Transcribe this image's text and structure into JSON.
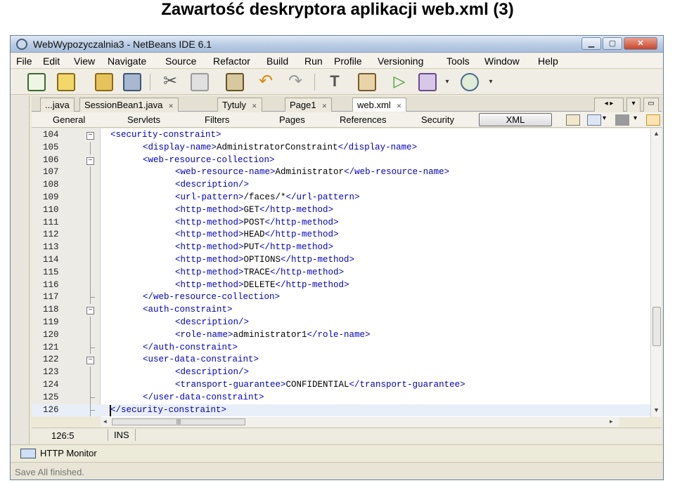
{
  "slide_title": "Zawartość deskryptora aplikacji web.xml (3)",
  "window": {
    "title": "WebWypozyczalnia3 - NetBeans IDE 6.1",
    "controls": [
      "minimize-icon",
      "maximize-icon",
      "close-icon"
    ]
  },
  "menu": [
    "File",
    "Edit",
    "View",
    "Navigate",
    "Source",
    "Refactor",
    "Build",
    "Run",
    "Profile",
    "Versioning",
    "Tools",
    "Window",
    "Help"
  ],
  "toolbar_icons": [
    "new-file-icon",
    "new-project-icon",
    "open-project-icon",
    "save-all-icon",
    "cut-icon",
    "copy-icon",
    "paste-icon",
    "undo-icon",
    "redo-icon",
    "build-icon",
    "clean-build-icon",
    "run-icon",
    "debug-icon",
    "profile-icon"
  ],
  "file_tabs": [
    {
      "label": "...java",
      "active": false
    },
    {
      "label": "SessionBean1.java",
      "active": false
    },
    {
      "label": "Tytuly",
      "active": false
    },
    {
      "label": "Page1",
      "active": false
    },
    {
      "label": "web.xml",
      "active": true
    }
  ],
  "multiview_tabs": [
    "General",
    "Servlets",
    "Filters",
    "Pages",
    "References",
    "Security",
    "XML"
  ],
  "active_view": "XML",
  "code_lines": [
    {
      "n": "104",
      "indent": 0,
      "text": "<security-constraint>"
    },
    {
      "n": "105",
      "indent": 1,
      "text": "<display-name>AdministratorConstraint</display-name>"
    },
    {
      "n": "106",
      "indent": 1,
      "text": "<web-resource-collection>"
    },
    {
      "n": "107",
      "indent": 2,
      "text": "<web-resource-name>Administrator</web-resource-name>"
    },
    {
      "n": "108",
      "indent": 2,
      "text": "<description/>"
    },
    {
      "n": "109",
      "indent": 2,
      "text": "<url-pattern>/faces/*</url-pattern>"
    },
    {
      "n": "110",
      "indent": 2,
      "text": "<http-method>GET</http-method>"
    },
    {
      "n": "111",
      "indent": 2,
      "text": "<http-method>POST</http-method>"
    },
    {
      "n": "112",
      "indent": 2,
      "text": "<http-method>HEAD</http-method>"
    },
    {
      "n": "113",
      "indent": 2,
      "text": "<http-method>PUT</http-method>"
    },
    {
      "n": "114",
      "indent": 2,
      "text": "<http-method>OPTIONS</http-method>"
    },
    {
      "n": "115",
      "indent": 2,
      "text": "<http-method>TRACE</http-method>"
    },
    {
      "n": "116",
      "indent": 2,
      "text": "<http-method>DELETE</http-method>"
    },
    {
      "n": "117",
      "indent": 1,
      "text": "</web-resource-collection>"
    },
    {
      "n": "118",
      "indent": 1,
      "text": "<auth-constraint>"
    },
    {
      "n": "119",
      "indent": 2,
      "text": "<description/>"
    },
    {
      "n": "120",
      "indent": 2,
      "text": "<role-name>administrator1</role-name>"
    },
    {
      "n": "121",
      "indent": 1,
      "text": "</auth-constraint>"
    },
    {
      "n": "122",
      "indent": 1,
      "text": "<user-data-constraint>"
    },
    {
      "n": "123",
      "indent": 2,
      "text": "<description/>"
    },
    {
      "n": "124",
      "indent": 2,
      "text": "<transport-guarantee>CONFIDENTIAL</transport-guarantee>"
    },
    {
      "n": "125",
      "indent": 1,
      "text": "</user-data-constraint>"
    },
    {
      "n": "126",
      "indent": 0,
      "text": "</security-constraint>"
    }
  ],
  "fold_open": [
    "104",
    "106",
    "118",
    "122"
  ],
  "fold_end": [
    "117",
    "121",
    "125",
    "126"
  ],
  "current_line": "126",
  "status": {
    "position": "126:5",
    "mode": "INS"
  },
  "output_panel": {
    "label": "HTTP Monitor"
  },
  "status_message": "Save All finished.",
  "colors": {
    "tag": "#0000c0",
    "text": "#000000",
    "gutter": "#ecebe6"
  }
}
